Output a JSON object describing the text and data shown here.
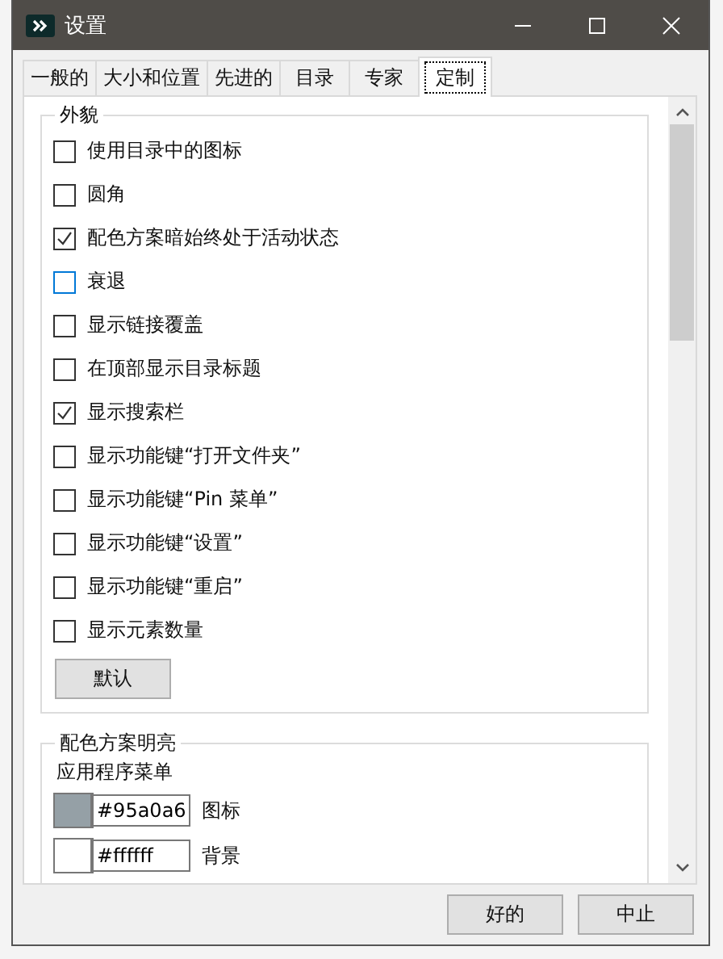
{
  "window": {
    "title": "设置"
  },
  "tabs": [
    {
      "label": "一般的",
      "selected": false
    },
    {
      "label": "大小和位置",
      "selected": false
    },
    {
      "label": "先进的",
      "selected": false
    },
    {
      "label": "目录",
      "selected": false
    },
    {
      "label": "专家",
      "selected": false
    },
    {
      "label": "定制",
      "selected": true
    }
  ],
  "appearance": {
    "title": "外貌",
    "options": [
      {
        "label": "使用目录中的图标",
        "checked": false,
        "focused": false
      },
      {
        "label": "圆角",
        "checked": false,
        "focused": false
      },
      {
        "label": "配色方案暗始终处于活动状态",
        "checked": true,
        "focused": false
      },
      {
        "label": "衰退",
        "checked": false,
        "focused": true
      },
      {
        "label": "显示链接覆盖",
        "checked": false,
        "focused": false
      },
      {
        "label": "在顶部显示目录标题",
        "checked": false,
        "focused": false
      },
      {
        "label": "显示搜索栏",
        "checked": true,
        "focused": false
      },
      {
        "label": "显示功能键“打开文件夹”",
        "checked": false,
        "focused": false
      },
      {
        "label": "显示功能键“Pin 菜单”",
        "checked": false,
        "focused": false
      },
      {
        "label": "显示功能键“设置”",
        "checked": false,
        "focused": false
      },
      {
        "label": "显示功能键“重启”",
        "checked": false,
        "focused": false
      },
      {
        "label": "显示元素数量",
        "checked": false,
        "focused": false
      }
    ],
    "default_button": "默认"
  },
  "light_scheme": {
    "title": "配色方案明亮",
    "subtitle": "应用程序菜单",
    "colors": [
      {
        "value": "#95a0a6",
        "label": "图标",
        "color": "#95a0a6"
      },
      {
        "value": "#ffffff",
        "label": "背景",
        "color": "#ffffff"
      }
    ]
  },
  "buttons": [
    "好的",
    "中止"
  ]
}
